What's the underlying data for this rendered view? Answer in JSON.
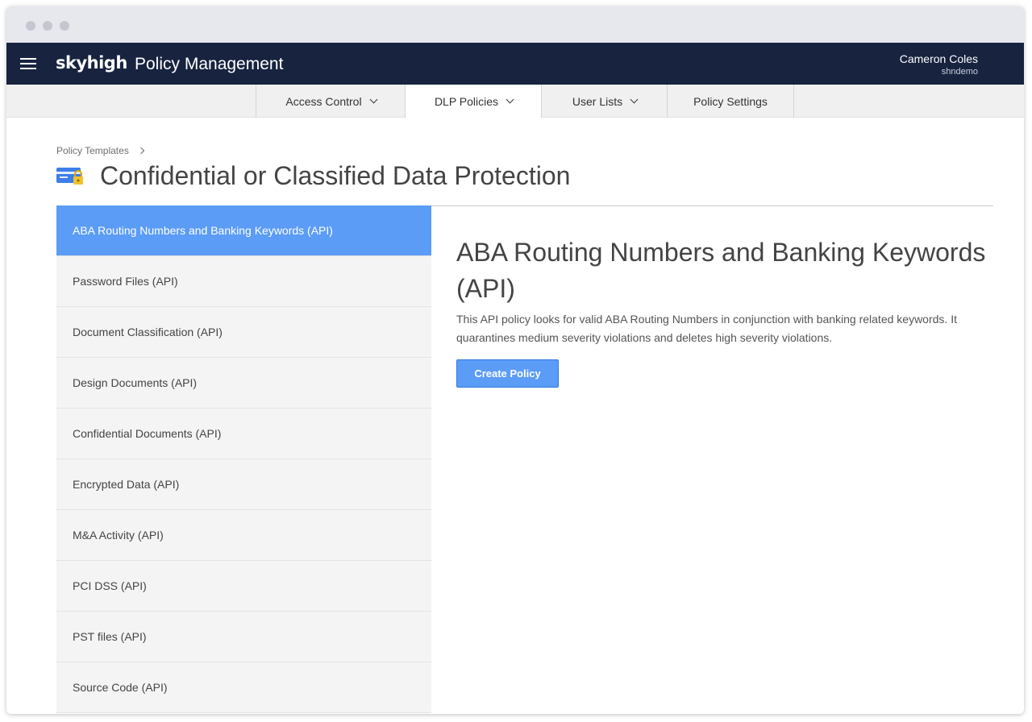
{
  "header": {
    "logo": "skyhigh",
    "app_title": "Policy Management",
    "user_name": "Cameron Coles",
    "user_org": "shndemo"
  },
  "subnav": {
    "items": [
      {
        "label": "Access Control",
        "has_dropdown": true,
        "active": false
      },
      {
        "label": "DLP Policies",
        "has_dropdown": true,
        "active": true
      },
      {
        "label": "User Lists",
        "has_dropdown": true,
        "active": false
      },
      {
        "label": "Policy Settings",
        "has_dropdown": false,
        "active": false
      }
    ]
  },
  "breadcrumb": {
    "label": "Policy Templates"
  },
  "page": {
    "title": "Confidential or Classified Data Protection"
  },
  "sidebar": {
    "items": [
      {
        "label": "ABA Routing Numbers and Banking Keywords (API)",
        "selected": true
      },
      {
        "label": "Password Files (API)",
        "selected": false
      },
      {
        "label": "Document Classification (API)",
        "selected": false
      },
      {
        "label": "Design Documents (API)",
        "selected": false
      },
      {
        "label": "Confidential Documents (API)",
        "selected": false
      },
      {
        "label": "Encrypted Data (API)",
        "selected": false
      },
      {
        "label": "M&A Activity (API)",
        "selected": false
      },
      {
        "label": "PCI DSS (API)",
        "selected": false
      },
      {
        "label": "PST files (API)",
        "selected": false
      },
      {
        "label": "Source Code (API)",
        "selected": false
      }
    ]
  },
  "detail": {
    "title": "ABA Routing Numbers and Banking Keywords (API)",
    "description": "This API policy looks for valid ABA Routing Numbers in conjunction with banking related keywords. It quarantines medium severity violations and deletes high severity violations.",
    "button_label": "Create Policy"
  },
  "colors": {
    "topbar": "#17233f",
    "accent": "#5b9cf6",
    "icon_card": "#3d7ee8",
    "icon_lock": "#f2c12e"
  }
}
